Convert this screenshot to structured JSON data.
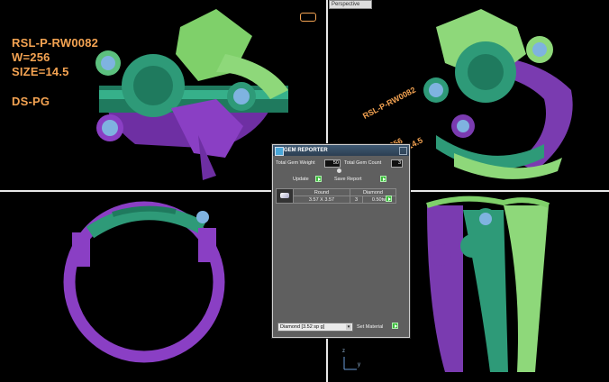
{
  "colors": {
    "orange_text": "#f4a352",
    "green_metal": "#8ed87a",
    "teal_metal": "#2e9a78",
    "purple_metal": "#7a3bb0",
    "gem": "#7fb3e0"
  },
  "info": {
    "line1": "RSL-P-RW0082",
    "line2": "W=256",
    "line3": "SIZE=14.5",
    "line4": "DS-PG"
  },
  "viewport": {
    "perspective_label": "Perspective"
  },
  "overlay_text": {
    "t1": "RSL-P-RW0082",
    "t2": "256",
    "t3": "14.5"
  },
  "gem_reporter": {
    "title": "GEM REPORTER",
    "total_gem_weight_label": "Total Gem Weight",
    "total_gem_weight_value": "50",
    "total_gem_count_label": "Total Gem Count",
    "total_gem_count_value": "3",
    "update_label": "Update",
    "save_report_label": "Save Report",
    "table": {
      "headers": [
        "Round",
        "Diamond"
      ],
      "row": {
        "size": "3.57 X 3.57",
        "count": "3",
        "weight": "0.50tw"
      }
    },
    "material_select": "Diamond   [3.52 sp g]",
    "set_material_label": "Set Material"
  },
  "axis": {
    "y": "y",
    "z": "z"
  }
}
